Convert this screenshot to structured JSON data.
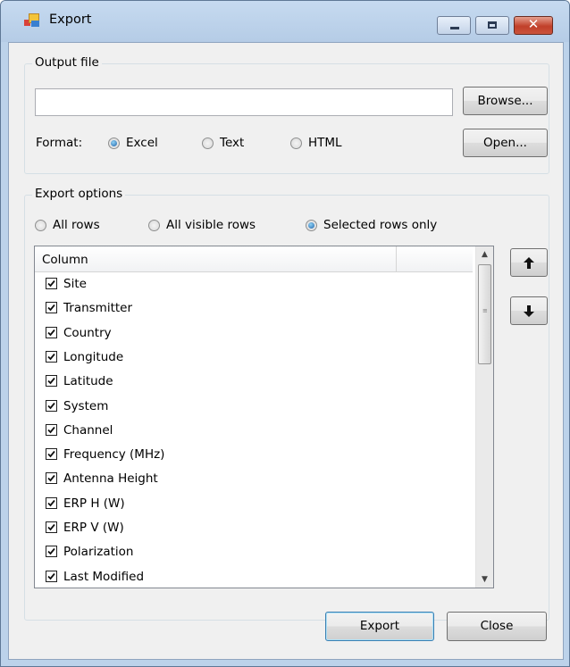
{
  "window": {
    "title": "Export"
  },
  "output_group": {
    "label": "Output file",
    "path_value": "",
    "browse_label": "Browse...",
    "open_label": "Open...",
    "format_label": "Format:",
    "formats": [
      {
        "label": "Excel",
        "selected": true
      },
      {
        "label": "Text",
        "selected": false
      },
      {
        "label": "HTML",
        "selected": false
      }
    ]
  },
  "options_group": {
    "label": "Export options",
    "row_modes": [
      {
        "label": "All rows",
        "selected": false
      },
      {
        "label": "All visible rows",
        "selected": false
      },
      {
        "label": "Selected rows only",
        "selected": true
      }
    ],
    "column_header": "Column",
    "columns": [
      {
        "label": "Site",
        "checked": true
      },
      {
        "label": "Transmitter",
        "checked": true
      },
      {
        "label": "Country",
        "checked": true
      },
      {
        "label": "Longitude",
        "checked": true
      },
      {
        "label": "Latitude",
        "checked": true
      },
      {
        "label": "System",
        "checked": true
      },
      {
        "label": "Channel",
        "checked": true
      },
      {
        "label": "Frequency (MHz)",
        "checked": true
      },
      {
        "label": "Antenna Height",
        "checked": true
      },
      {
        "label": "ERP H (W)",
        "checked": true
      },
      {
        "label": "ERP V (W)",
        "checked": true
      },
      {
        "label": "Polarization",
        "checked": true
      },
      {
        "label": "Last Modified",
        "checked": true
      }
    ]
  },
  "footer": {
    "export_label": "Export",
    "close_label": "Close"
  }
}
